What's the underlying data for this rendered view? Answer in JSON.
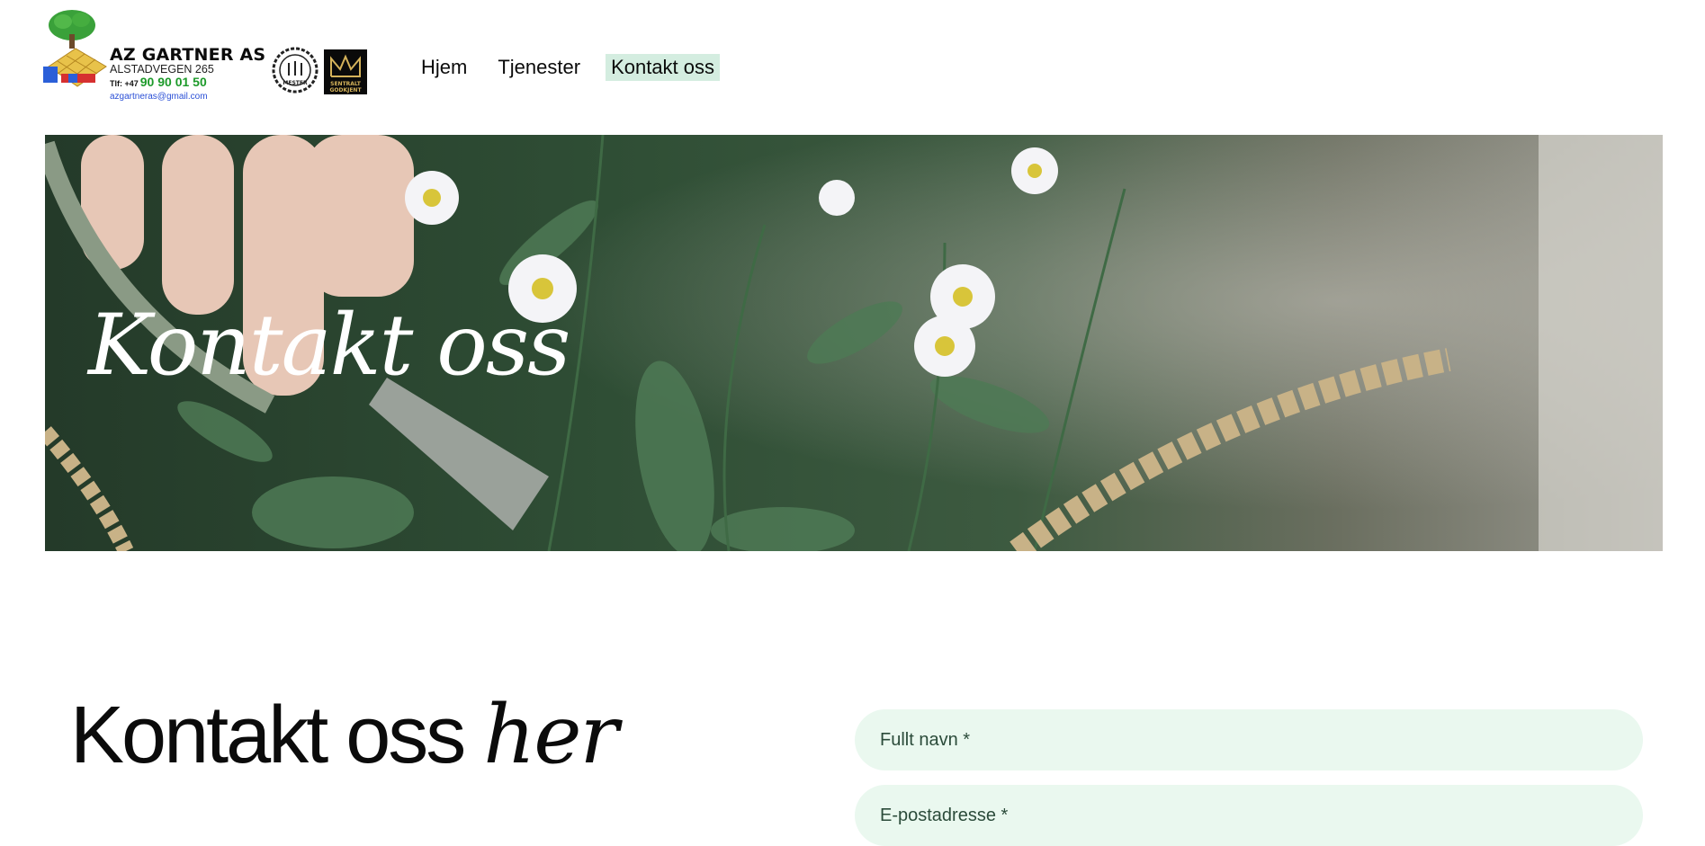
{
  "brand": {
    "name": "AZ GARTNER AS",
    "address": "ALSTADVEGEN 265",
    "phone_prefix": "Tlf: +47",
    "phone": "90 90 01 50",
    "email": "azgartneras@gmail.com"
  },
  "badges": {
    "mester": "MESTER",
    "sentralt_line1": "SENTRALT",
    "sentralt_line2": "GODKJENT"
  },
  "nav": {
    "items": [
      {
        "label": "Hjem",
        "active": false
      },
      {
        "label": "Tjenester",
        "active": false
      },
      {
        "label": "Kontakt oss",
        "active": true
      }
    ]
  },
  "hero": {
    "title": "Kontakt oss"
  },
  "contact": {
    "heading_main": "Kontakt oss",
    "heading_em": "her"
  },
  "form": {
    "full_name_placeholder": "Fullt navn *",
    "email_placeholder": "E-postadresse *"
  },
  "colors": {
    "nav_active_bg": "#d4ede0",
    "field_bg": "#eaf8ef",
    "phone_green": "#1d9a2a"
  }
}
